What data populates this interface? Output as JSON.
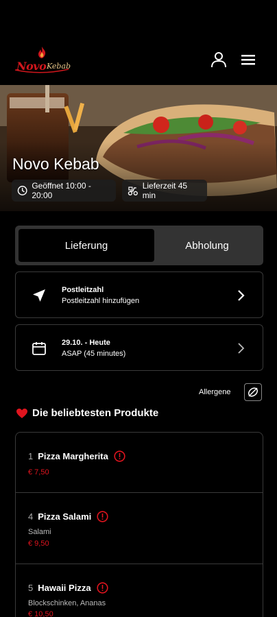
{
  "header": {
    "logo_text": "Novo",
    "logo_subtext": "Kebab",
    "icons": [
      "user-icon",
      "menu-icon"
    ]
  },
  "hero": {
    "title": "Novo Kebab",
    "opening_hours": "Geöffnet 10:00 - 20:00",
    "delivery_time": "Lieferzeit 45 min"
  },
  "order_mode": {
    "delivery_label": "Lieferung",
    "pickup_label": "Abholung",
    "selected": "Lieferung"
  },
  "postal": {
    "title": "Postleitzahl",
    "subtitle": "Postleitzahl hinzufügen"
  },
  "schedule": {
    "title": "29.10. - Heute",
    "subtitle": "ASAP (45 minutes)"
  },
  "allergens_label": "Allergene",
  "popular": {
    "title": "Die beliebtesten Produkte",
    "items": [
      {
        "num": "1",
        "name": "Pizza Margherita",
        "desc": "",
        "price": "€ 7,50"
      },
      {
        "num": "4",
        "name": "Pizza Salami",
        "desc": "Salami",
        "price": "€ 9,50"
      },
      {
        "num": "5",
        "name": "Hawaii Pizza",
        "desc": "Blockschinken, Ananas",
        "price": "€ 10,50"
      }
    ]
  },
  "colors": {
    "accent_red": "#e0141e",
    "background": "#000000",
    "toggle_bg": "#333333",
    "border": "#3a3a3a"
  }
}
